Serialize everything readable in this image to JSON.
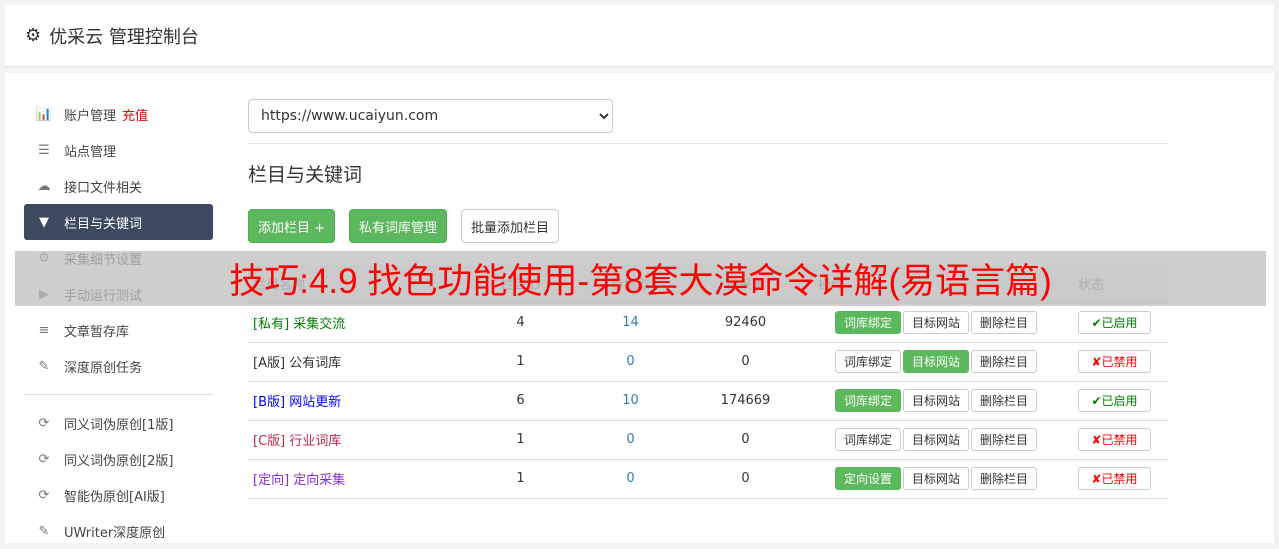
{
  "header": {
    "title": "优采云 管理控制台",
    "icon": "gear-icon"
  },
  "sidebar": {
    "items": [
      {
        "label": "账户管理",
        "extra": "充值",
        "icon": "bar-chart-icon",
        "glyph": "📊"
      },
      {
        "label": "站点管理",
        "icon": "server-icon",
        "glyph": "☰"
      },
      {
        "label": "接口文件相关",
        "icon": "cloud-upload-icon",
        "glyph": "☁"
      },
      {
        "label": "栏目与关键词",
        "icon": "filter-icon",
        "glyph": "▼",
        "active": true
      },
      {
        "label": "采集细节设置",
        "icon": "gears-icon",
        "glyph": "⚙"
      },
      {
        "label": "手动运行测试",
        "icon": "play-circle-icon",
        "glyph": "▶"
      },
      {
        "label": "文章暂存库",
        "icon": "database-icon",
        "glyph": "≡"
      },
      {
        "label": "深度原创任务",
        "icon": "edit-icon",
        "glyph": "✎"
      },
      {
        "label": "同义词伪原创[1版]",
        "icon": "refresh-icon",
        "glyph": "⟳"
      },
      {
        "label": "同义词伪原创[2版]",
        "icon": "refresh-icon",
        "glyph": "⟳"
      },
      {
        "label": "智能伪原创[AI版]",
        "icon": "refresh-icon",
        "glyph": "⟳"
      },
      {
        "label": "UWriter深度原创",
        "icon": "edit-icon",
        "glyph": "✎"
      }
    ]
  },
  "main": {
    "site_select": "https://www.ucaiyun.com",
    "section_title": "栏目与关键词",
    "buttons": {
      "add": "添加栏目 +",
      "private": "私有词库管理",
      "batch": "批量添加栏目"
    },
    "table": {
      "headers": [
        "栏目名称",
        "栏目ID",
        "待抓取",
        "已采集",
        "操作",
        "状态"
      ],
      "rows": [
        {
          "tag": "[私有]",
          "name": "采集交流",
          "color": "#008000",
          "id": "4",
          "pending": "14",
          "collected": "92460",
          "op1": "词库绑定",
          "op1_active": true,
          "op2": "目标网站",
          "op2_active": false,
          "op3": "删除栏目",
          "status": "已启用",
          "enabled": true
        },
        {
          "tag": "[A版]",
          "name": "公有词库",
          "color": "#333333",
          "id": "1",
          "pending": "0",
          "collected": "0",
          "op1": "词库绑定",
          "op1_active": false,
          "op2": "目标网站",
          "op2_active": true,
          "op3": "删除栏目",
          "status": "已禁用",
          "enabled": false
        },
        {
          "tag": "[B版]",
          "name": "网站更新",
          "color": "#0000ff",
          "id": "6",
          "pending": "10",
          "collected": "174669",
          "op1": "词库绑定",
          "op1_active": true,
          "op2": "目标网站",
          "op2_active": false,
          "op3": "删除栏目",
          "status": "已启用",
          "enabled": true
        },
        {
          "tag": "[C版]",
          "name": "行业词库",
          "color": "#c7254e",
          "id": "1",
          "pending": "0",
          "collected": "0",
          "op1": "词库绑定",
          "op1_active": false,
          "op2": "目标网站",
          "op2_active": false,
          "op3": "删除栏目",
          "status": "已禁用",
          "enabled": false
        },
        {
          "tag": "[定向]",
          "name": "定向采集",
          "color": "#8a2be2",
          "id": "1",
          "pending": "0",
          "collected": "0",
          "op1": "定向设置",
          "op1_active": true,
          "op2": "目标网站",
          "op2_active": false,
          "op3": "删除栏目",
          "status": "已禁用",
          "enabled": false
        }
      ]
    }
  },
  "overlay": {
    "text": "技巧:4.9 找色功能使用-第8套大漠命令详解(易语言篇)"
  },
  "colors": {
    "accent": "#5cb85c",
    "active_nav": "#3c4a60",
    "enabled": "#008000",
    "disabled": "#ff0000"
  }
}
